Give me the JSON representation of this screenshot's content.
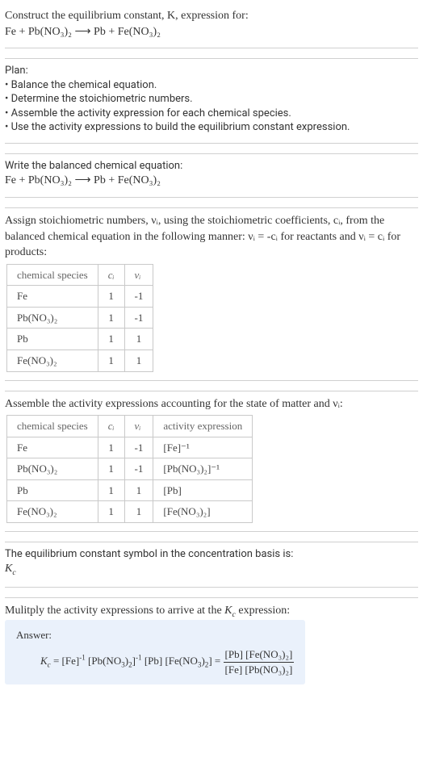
{
  "header": {
    "title_line": "Construct the equilibrium constant, K, expression for:",
    "equation": "Fe + Pb(NO₃)₂ ⟶ Pb + Fe(NO₃)₂"
  },
  "plan": {
    "heading": "Plan:",
    "bullets": [
      "Balance the chemical equation.",
      "Determine the stoichiometric numbers.",
      "Assemble the activity expression for each chemical species.",
      "Use the activity expressions to build the equilibrium constant expression."
    ]
  },
  "balanced": {
    "heading": "Write the balanced chemical equation:",
    "equation": "Fe + Pb(NO₃)₂ ⟶ Pb + Fe(NO₃)₂"
  },
  "stoich_text": {
    "before": "Assign stoichiometric numbers, νᵢ, using the stoichiometric coefficients, cᵢ, from the balanced chemical equation in the following manner: νᵢ = -cᵢ for reactants and νᵢ = cᵢ for products:"
  },
  "stoich_table": {
    "headers": [
      "chemical species",
      "cᵢ",
      "νᵢ"
    ],
    "rows": [
      [
        "Fe",
        "1",
        "-1"
      ],
      [
        "Pb(NO₃)₂",
        "1",
        "-1"
      ],
      [
        "Pb",
        "1",
        "1"
      ],
      [
        "Fe(NO₃)₂",
        "1",
        "1"
      ]
    ]
  },
  "activity_heading": "Assemble the activity expressions accounting for the state of matter and νᵢ:",
  "activity_table": {
    "headers": [
      "chemical species",
      "cᵢ",
      "νᵢ",
      "activity expression"
    ],
    "rows": [
      [
        "Fe",
        "1",
        "-1",
        "[Fe]⁻¹"
      ],
      [
        "Pb(NO₃)₂",
        "1",
        "-1",
        "[Pb(NO₃)₂]⁻¹"
      ],
      [
        "Pb",
        "1",
        "1",
        "[Pb]"
      ],
      [
        "Fe(NO₃)₂",
        "1",
        "1",
        "[Fe(NO₃)₂]"
      ]
    ]
  },
  "kc_symbol": {
    "line1": "The equilibrium constant symbol in the concentration basis is:",
    "line2": "K_c"
  },
  "multiply_heading": "Mulitply the activity expressions to arrive at the K_c expression:",
  "answer": {
    "label": "Answer:",
    "expr_left": "K_c = [Fe]⁻¹ [Pb(NO₃)₂]⁻¹ [Pb] [Fe(NO₃)₂] =",
    "frac_num": "[Pb] [Fe(NO₃)₂]",
    "frac_den": "[Fe] [Pb(NO₃)₂]"
  }
}
